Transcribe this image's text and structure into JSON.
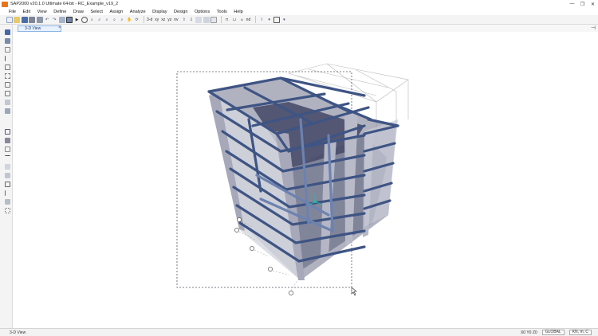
{
  "window": {
    "title": "SAP2000 v20.1.0 Ultimate 64-bit - RC_Example_v19_2",
    "controls": [
      "—",
      "❐",
      "✕"
    ]
  },
  "menu": [
    "File",
    "Edit",
    "View",
    "Define",
    "Draw",
    "Select",
    "Assign",
    "Analyze",
    "Display",
    "Design",
    "Options",
    "Tools",
    "Help"
  ],
  "toolbar": {
    "view_3d": "3-d",
    "view_xy": "xy",
    "view_xz": "xz",
    "view_yz": "yz",
    "view_nv": "nv",
    "view_nd": "nd"
  },
  "tab": {
    "label": "3-D View",
    "close": "×",
    "pin": "⊣"
  },
  "status": {
    "left": "3-D View",
    "axes": "X0  Y0  Z0",
    "coord_system": "GLOBAL",
    "units": "KN, m, C"
  },
  "colors": {
    "beam": "#3e5484",
    "beam_light": "#6c82b0",
    "column": "#a7a9ba",
    "slab": "#6f728a",
    "grid": "#b8b8b8",
    "selection": "#555566"
  }
}
